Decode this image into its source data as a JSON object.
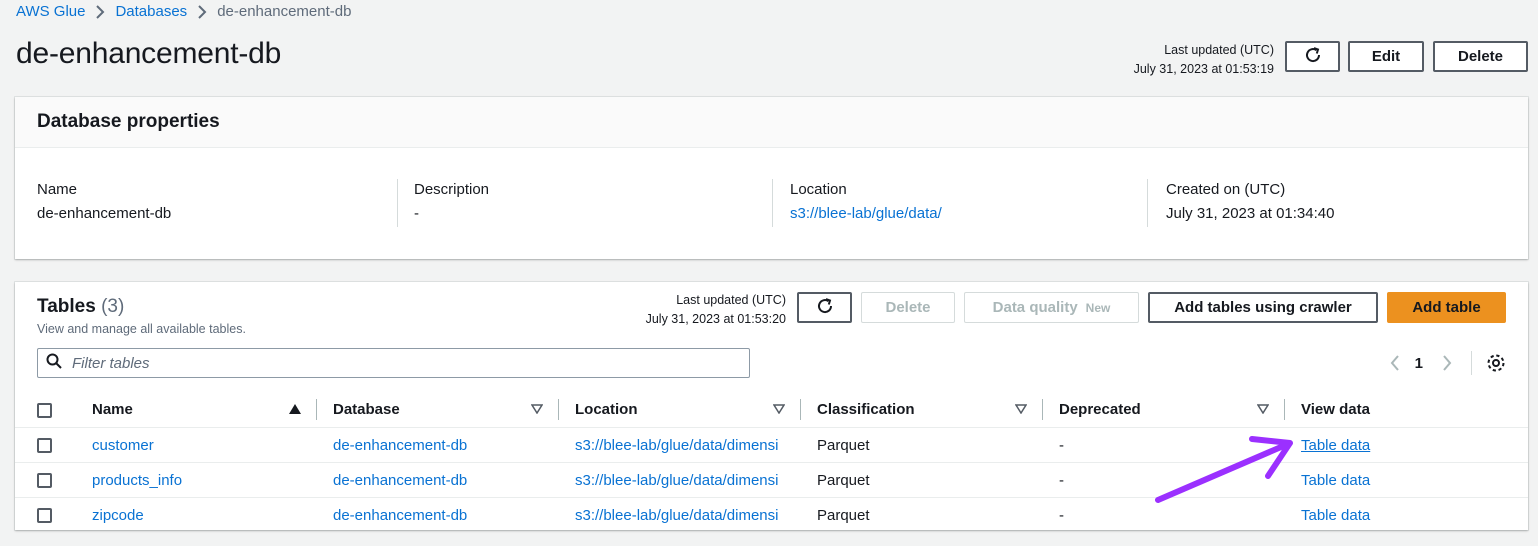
{
  "breadcrumb": {
    "items": [
      "AWS Glue",
      "Databases"
    ],
    "current": "de-enhancement-db"
  },
  "header": {
    "title": "de-enhancement-db",
    "last_updated_label": "Last updated (UTC)",
    "last_updated_value": "July 31, 2023 at 01:53:19",
    "edit_label": "Edit",
    "delete_label": "Delete"
  },
  "properties": {
    "heading": "Database properties",
    "fields": [
      {
        "label": "Name",
        "value": "de-enhancement-db"
      },
      {
        "label": "Description",
        "value": "-"
      },
      {
        "label": "Location",
        "value": "s3://blee-lab/glue/data/"
      },
      {
        "label": "Created on (UTC)",
        "value": "July 31, 2023 at 01:34:40"
      }
    ]
  },
  "tables": {
    "title": "Tables",
    "count": "(3)",
    "description": "View and manage all available tables.",
    "last_updated_label": "Last updated (UTC)",
    "last_updated_value": "July 31, 2023 at 01:53:20",
    "delete_label": "Delete",
    "data_quality_label": "Data quality",
    "data_quality_badge": "New",
    "add_crawler_label": "Add tables using crawler",
    "add_table_label": "Add table",
    "filter_placeholder": "Filter tables",
    "page": "1",
    "columns": [
      "Name",
      "Database",
      "Location",
      "Classification",
      "Deprecated",
      "View data"
    ],
    "rows": [
      {
        "name": "customer",
        "database": "de-enhancement-db",
        "location": "s3://blee-lab/glue/data/dimensi",
        "classification": "Parquet",
        "deprecated": "-",
        "view": "Table data"
      },
      {
        "name": "products_info",
        "database": "de-enhancement-db",
        "location": "s3://blee-lab/glue/data/dimensi",
        "classification": "Parquet",
        "deprecated": "-",
        "view": "Table data"
      },
      {
        "name": "zipcode",
        "database": "de-enhancement-db",
        "location": "s3://blee-lab/glue/data/dimensi",
        "classification": "Parquet",
        "deprecated": "-",
        "view": "Table data"
      }
    ]
  },
  "colors": {
    "link": "#0972d3",
    "primary": "#ec911f",
    "annotation_arrow": "#9b30ff"
  }
}
